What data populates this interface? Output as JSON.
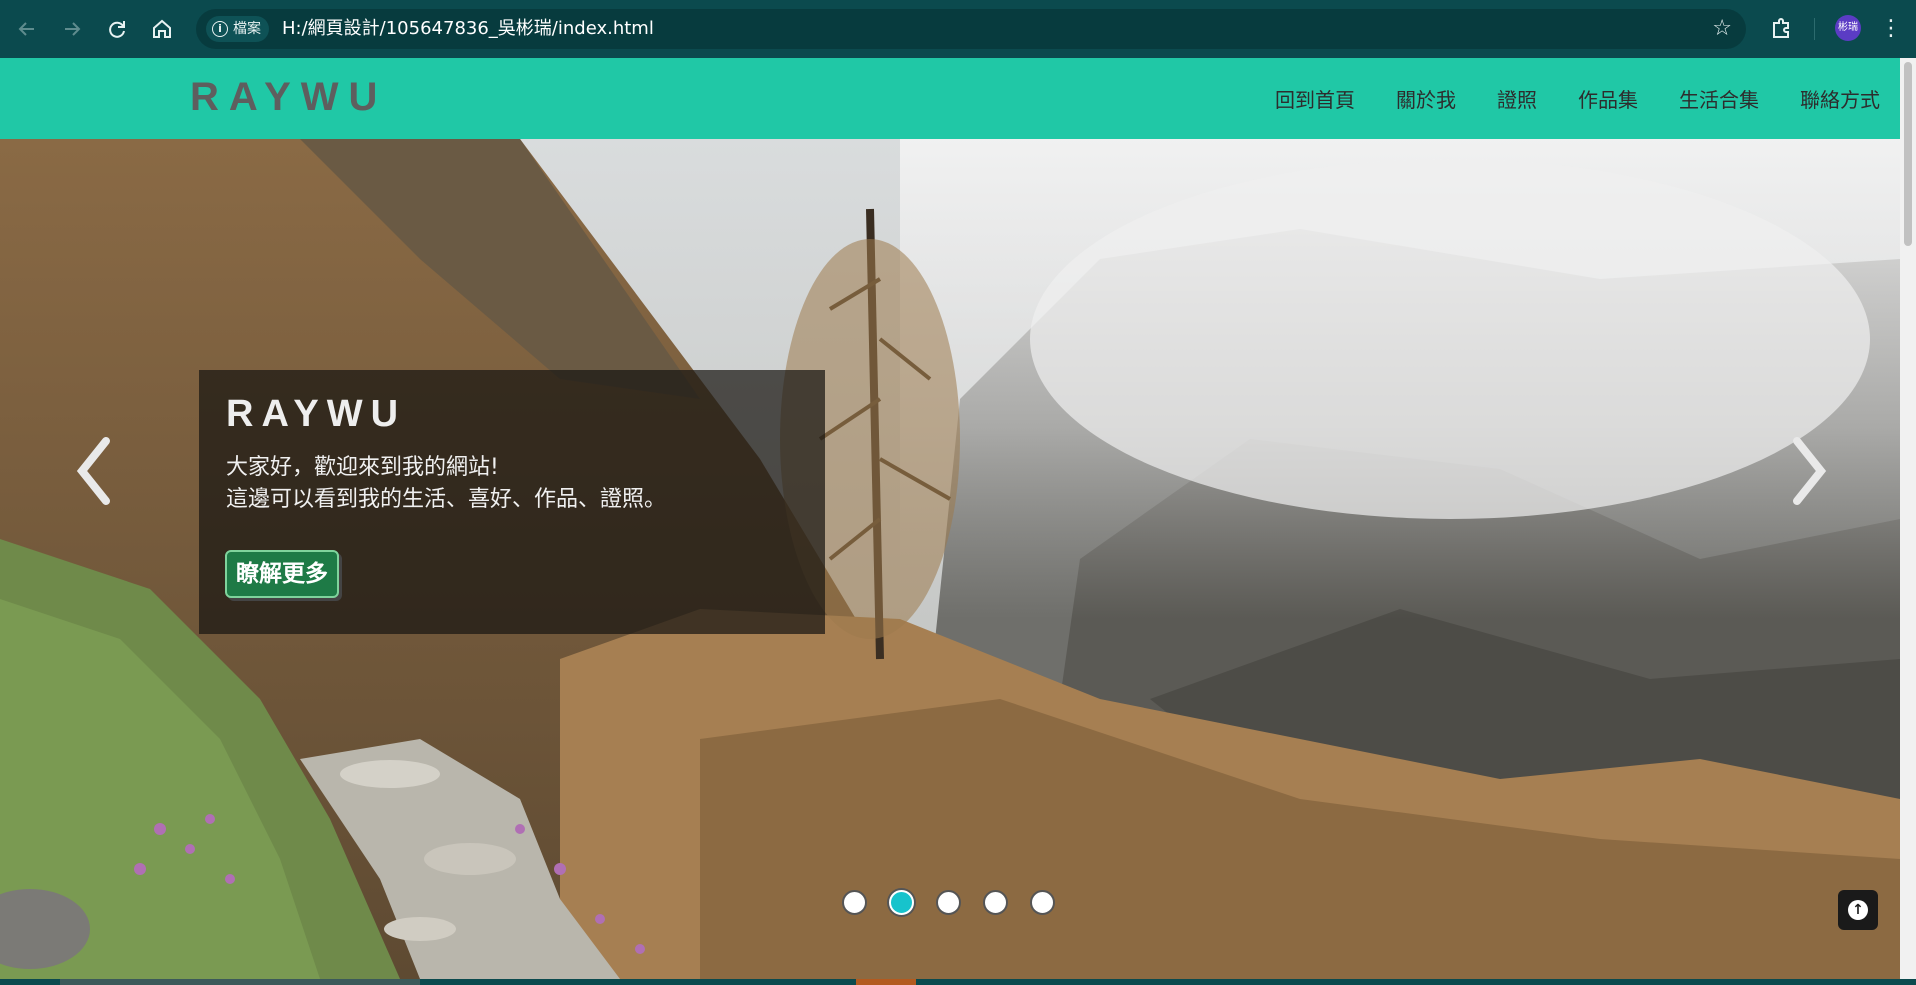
{
  "browser": {
    "back_icon": "arrow-left-icon",
    "forward_icon": "arrow-right-icon",
    "reload_icon": "reload-icon",
    "home_icon": "home-icon",
    "site_info_label": "檔案",
    "url": "H:/網頁設計/105647836_吳彬瑞/index.html",
    "profile_label": "彬瑞"
  },
  "site": {
    "brand": "RAYWU",
    "menu": [
      "回到首頁",
      "關於我",
      "證照",
      "作品集",
      "生活合集",
      "聯絡方式"
    ]
  },
  "hero": {
    "title": "RAYWU",
    "line1": "大家好，歡迎來到我的網站!",
    "line2": "這邊可以看到我的生活、喜好、作品、證照。",
    "button_label": "瞭解更多",
    "slide_count": 5,
    "active_slide": 2
  },
  "colors": {
    "nav_bg": "#20c8a6",
    "brand_text": "#5e5e5e",
    "button_bg": "#1e7a46",
    "active_dot": "#17c3cc",
    "browser_bg": "#0b4a4e"
  }
}
